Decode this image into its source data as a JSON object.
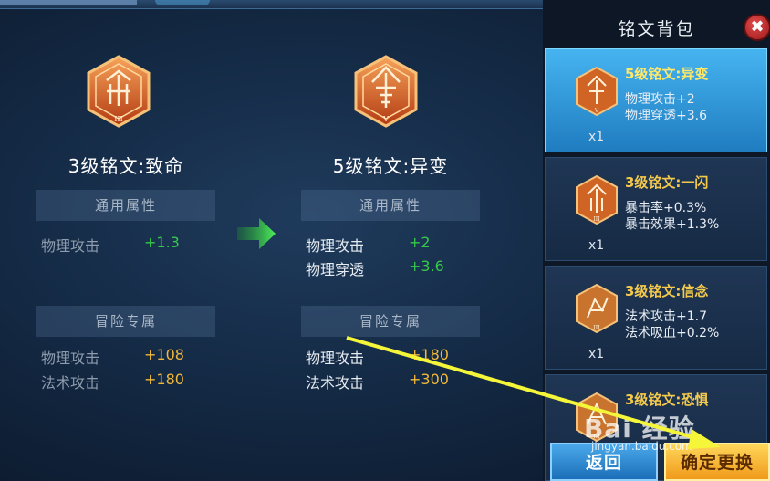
{
  "current_rune": {
    "title": "3级铭文:致命",
    "tier_numeral": "III",
    "common_header": "通用属性",
    "common_stats": [
      {
        "name": "物理攻击",
        "value": "+1.3"
      }
    ],
    "adventure_header": "冒险专属",
    "adventure_stats": [
      {
        "name": "物理攻击",
        "value": "+108"
      },
      {
        "name": "法术攻击",
        "value": "+180"
      }
    ]
  },
  "new_rune": {
    "title": "5级铭文:异变",
    "tier_numeral": "V",
    "common_header": "通用属性",
    "common_stats": [
      {
        "name": "物理攻击",
        "value": "+2"
      },
      {
        "name": "物理穿透",
        "value": "+3.6"
      }
    ],
    "adventure_header": "冒险专属",
    "adventure_stats": [
      {
        "name": "物理攻击",
        "value": "+180"
      },
      {
        "name": "法术攻击",
        "value": "+300"
      }
    ]
  },
  "panel": {
    "title": "铭文背包",
    "close_icon": "close-icon",
    "items": [
      {
        "title": "5级铭文:异变",
        "line1": "物理攻击+2",
        "line2": "物理穿透+3.6",
        "count": "x1",
        "numeral": "V",
        "selected": true
      },
      {
        "title": "3级铭文:一闪",
        "line1": "暴击率+0.3%",
        "line2": "暴击效果+1.3%",
        "count": "x1",
        "numeral": "III",
        "selected": false
      },
      {
        "title": "3级铭文:信念",
        "line1": "法术攻击+1.7",
        "line2": "法术吸血+0.2%",
        "count": "x1",
        "numeral": "III",
        "selected": false
      },
      {
        "title": "3级铭文:恐惧",
        "line1": "",
        "line2": "",
        "count": "",
        "numeral": "III",
        "selected": false
      }
    ]
  },
  "buttons": {
    "back": "返回",
    "confirm": "确定更换"
  },
  "watermark": {
    "text": "Bai 经验",
    "sub": "jingyan.baidu.com"
  },
  "colors": {
    "stat_green": "#35c94b",
    "stat_gold": "#f2b83a",
    "card_title_gold": "#f4c94c",
    "selected_card_blue": "#46b4f0",
    "confirm_orange": "#f09a1a",
    "back_blue": "#1b6fb8"
  }
}
